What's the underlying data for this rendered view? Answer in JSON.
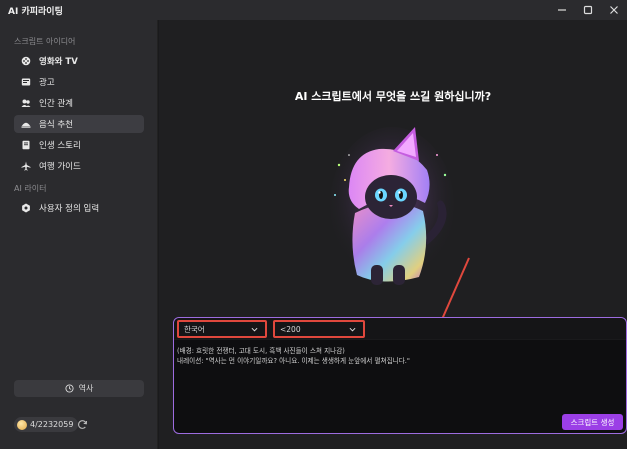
{
  "window": {
    "title": "AI 카피라이팅"
  },
  "sidebar": {
    "section1": "스크립트 아이디어",
    "items": [
      {
        "label": "영화와 TV",
        "icon": "film-icon"
      },
      {
        "label": "광고",
        "icon": "ad-icon"
      },
      {
        "label": "인간 관계",
        "icon": "people-icon"
      },
      {
        "label": "음식 추천",
        "icon": "food-icon",
        "active": true
      },
      {
        "label": "인생 스토리",
        "icon": "book-icon"
      },
      {
        "label": "여행 가이드",
        "icon": "airplane-icon"
      }
    ],
    "section2": "AI 라이터",
    "custom_item": {
      "label": "사용자 정의 입력",
      "icon": "gear-icon"
    },
    "history_label": "역사",
    "credits": "4/2232059"
  },
  "main": {
    "headline": "AI 스크립트에서 무엇을 쓰길 원하십니까?",
    "language_select": "한국어",
    "length_select": "<200",
    "prompt_line1": "(배경: 흐릿한 전쟁터, 고대 도시, 흑백 사진들이 스쳐 지나감)",
    "prompt_line2": "내레이션: \"역사는 먼 이야기일까요? 아니요. 이제는 생생하게 눈앞에서 펼쳐집니다.\"",
    "generate_label": "스크립트 생성"
  },
  "colors": {
    "accent": "#9b3fe6",
    "highlight_box": "#e0483d",
    "composer_border": "#9d6ce0"
  }
}
